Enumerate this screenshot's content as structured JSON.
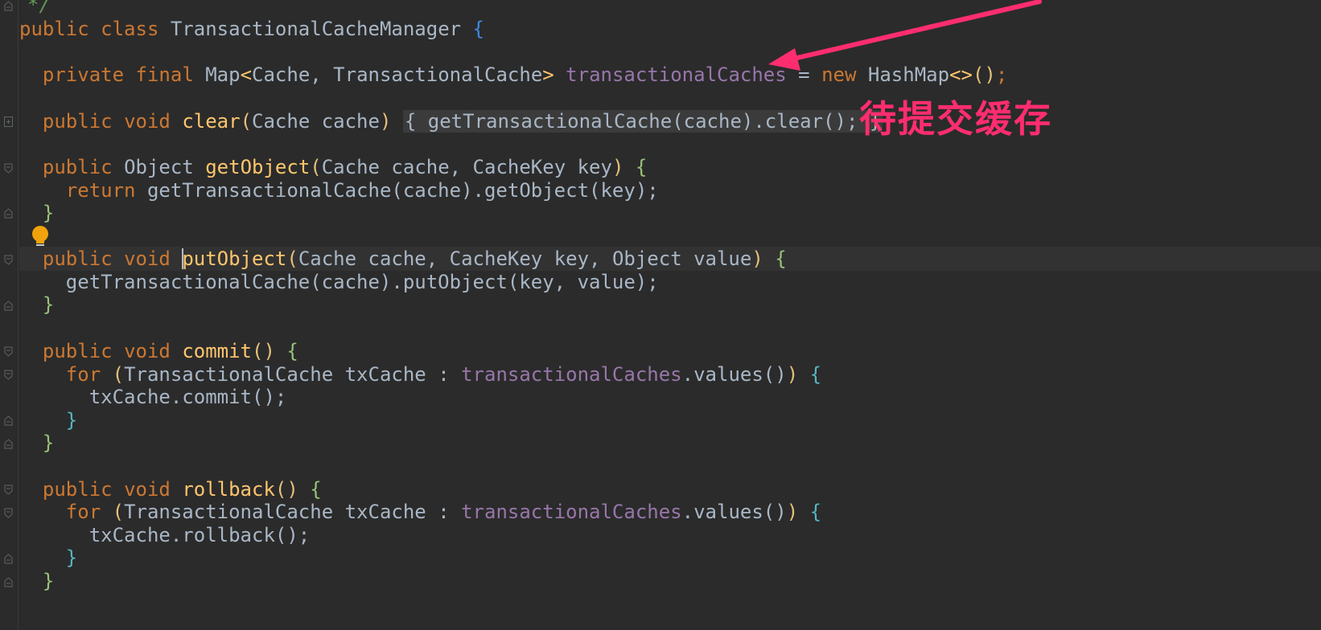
{
  "annotation": {
    "text": "待提交缓存",
    "color": "#ff2d6f"
  },
  "colors": {
    "background": "#2b2b2b",
    "keyword": "#cc7832",
    "method": "#ffc66d",
    "field": "#9876aa",
    "default_text": "#a9b7c6"
  },
  "code": {
    "l0_comment": "*/",
    "l1_public": "public",
    "l1_class": "class",
    "l1_name": "TransactionalCacheManager",
    "l1_brace": "{",
    "l3_private": "private",
    "l3_final": "final",
    "l3_type": "Map",
    "l3_generic": "Cache, TransactionalCache",
    "l3_field": "transactionalCaches",
    "l3_eq": "=",
    "l3_new": "new",
    "l3_ctor": "HashMap",
    "l5_public": "public",
    "l5_void": "void",
    "l5_name": "clear",
    "l5_params": "Cache cache",
    "l5_body": "{ getTransactionalCache(cache).clear(); }",
    "l7_public": "public",
    "l7_type": "Object",
    "l7_name": "getObject",
    "l7_params": "Cache cache, CacheKey key",
    "l8_return": "return",
    "l8_body": "getTransactionalCache(cache).getObject(key);",
    "l11_public": "public",
    "l11_void": "void",
    "l11_name": "putObject",
    "l11_params": "Cache cache, CacheKey key, Object value",
    "l12_body": "getTransactionalCache(cache).putObject(key, value);",
    "l15_public": "public",
    "l15_void": "void",
    "l15_name": "commit",
    "l16_for": "for",
    "l16_decl": "TransactionalCache txCache : ",
    "l16_field": "transactionalCaches",
    "l16_tail": ".values()",
    "l17_body": "txCache.commit();",
    "l21_public": "public",
    "l21_void": "void",
    "l21_name": "rollback",
    "l22_for": "for",
    "l22_decl": "TransactionalCache txCache : ",
    "l22_field": "transactionalCaches",
    "l22_tail": ".values()",
    "l23_body": "txCache.rollback();"
  },
  "icons": [
    "fold-icon",
    "lightbulb-icon",
    "arrow-annotation"
  ]
}
